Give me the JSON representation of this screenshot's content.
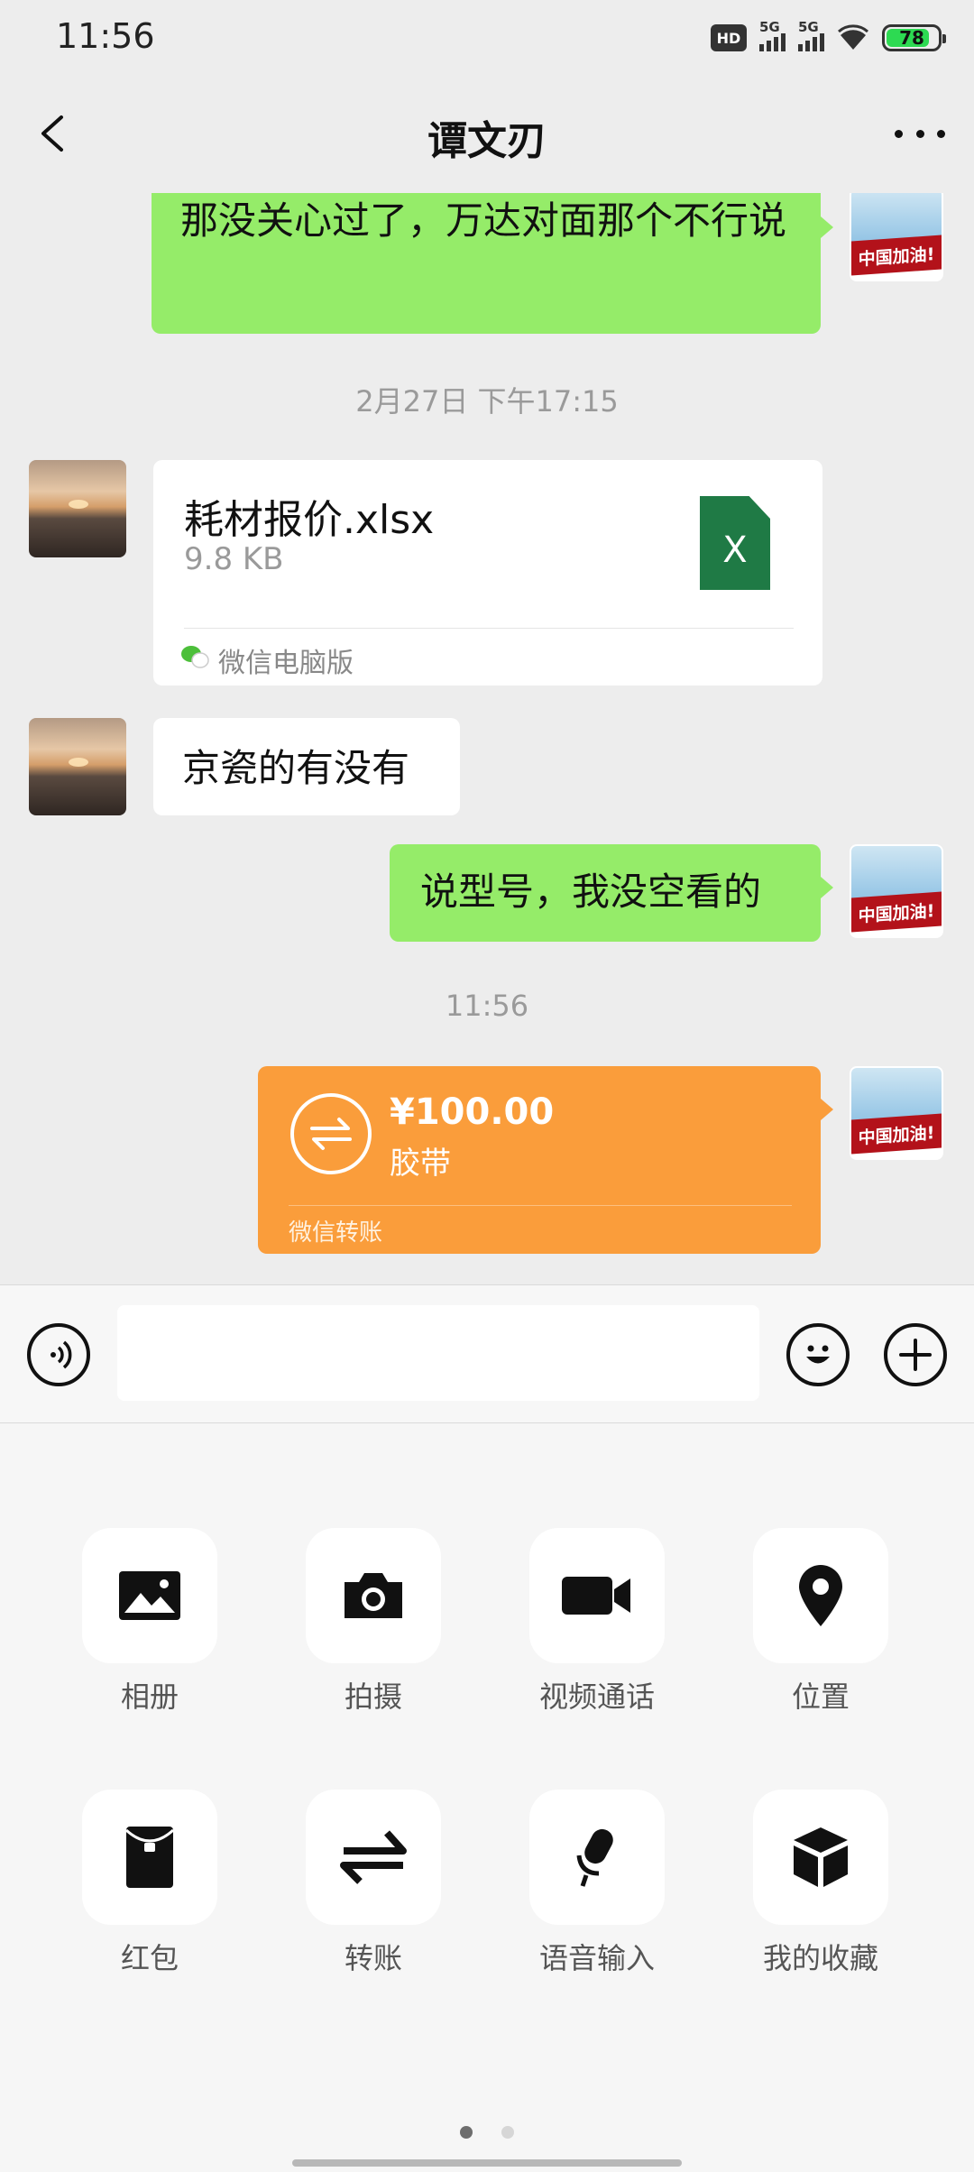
{
  "status_bar": {
    "time": "11:56",
    "hd_label": "HD",
    "signal_1_label": "5G",
    "signal_2_label": "5G",
    "battery": "78"
  },
  "header": {
    "title": "谭文刃"
  },
  "messages": [
    {
      "side": "self",
      "type": "text",
      "text": "那没关心过了，万达对面那个不行说"
    },
    {
      "type": "timestamp",
      "text": "2月27日 下午17:15"
    },
    {
      "side": "other",
      "type": "file",
      "file_name": "耗材报价.xlsx",
      "file_size": "9.8 KB",
      "file_type": "X",
      "source": "微信电脑版"
    },
    {
      "side": "other",
      "type": "text",
      "text": "京瓷的有没有"
    },
    {
      "side": "self",
      "type": "text",
      "text": "说型号，我没空看的"
    },
    {
      "type": "timestamp",
      "text": "11:56"
    },
    {
      "side": "self",
      "type": "transfer",
      "amount": "¥100.00",
      "note": "胶带",
      "label": "微信转账"
    }
  ],
  "self_avatar_text": "中国加油!",
  "input": {
    "value": "",
    "placeholder": ""
  },
  "tools": [
    {
      "label": "相册",
      "icon": "photo-album-icon"
    },
    {
      "label": "拍摄",
      "icon": "camera-icon"
    },
    {
      "label": "视频通话",
      "icon": "video-call-icon"
    },
    {
      "label": "位置",
      "icon": "location-icon"
    },
    {
      "label": "红包",
      "icon": "red-packet-icon"
    },
    {
      "label": "转账",
      "icon": "transfer-icon"
    },
    {
      "label": "语音输入",
      "icon": "microphone-icon"
    },
    {
      "label": "我的收藏",
      "icon": "favorites-icon"
    }
  ],
  "pagination": {
    "pages": 2,
    "current": 1
  },
  "colors": {
    "background": "#EDEDED",
    "self_bubble": "#95EC69",
    "transfer": "#FA9D3B",
    "excel": "#1F7A45"
  }
}
